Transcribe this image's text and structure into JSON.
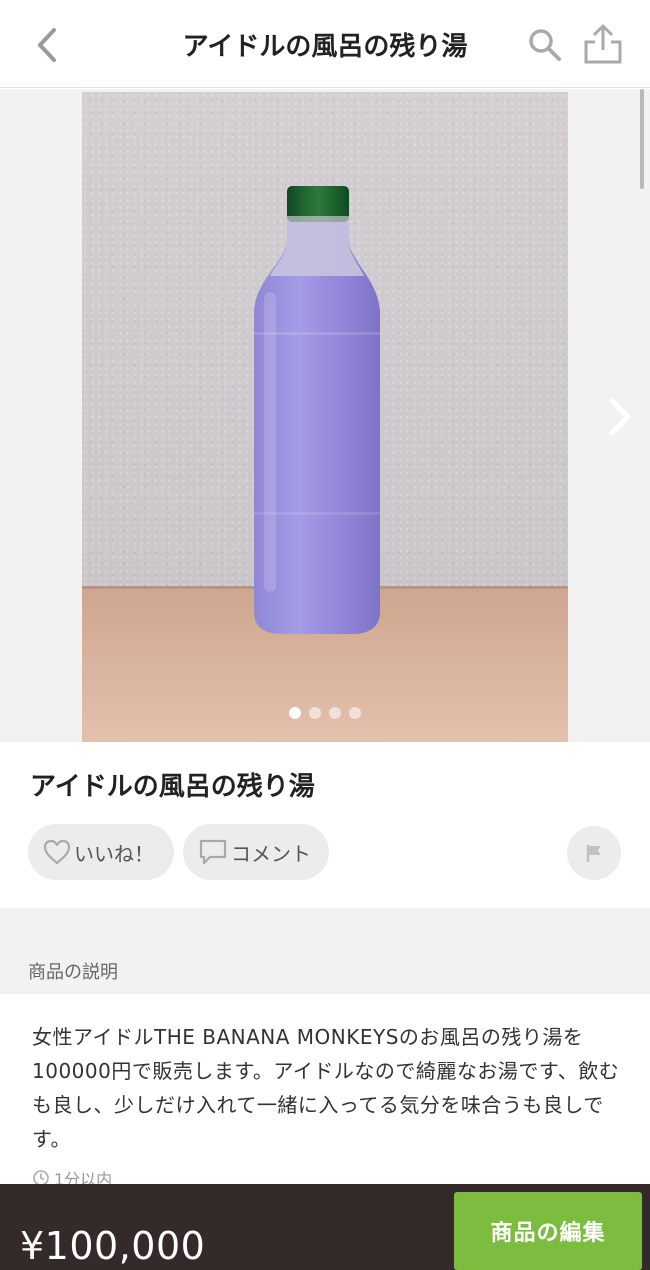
{
  "header": {
    "title": "アイドルの風呂の残り湯",
    "back_icon": "chevron-left-icon",
    "search_icon": "search-icon",
    "share_icon": "share-icon"
  },
  "gallery": {
    "photo_count": 4,
    "active_index": 0,
    "next_icon": "chevron-right-icon"
  },
  "item": {
    "title": "アイドルの風呂の残り湯",
    "like_label": "いいね！",
    "comment_label": "コメント",
    "flag_icon": "flag-icon"
  },
  "section": {
    "description_label": "商品の説明",
    "description": "女性アイドルTHE BANANA MONKEYSのお風呂の残り湯を100000円で販売します。アイドルなので綺麗なお湯です、飲むも良し、少しだけ入れて一緒に入ってる気分を味合うも良しです。",
    "posted_time": "1分以内"
  },
  "footer": {
    "price": "¥100,000",
    "edit_label": "商品の編集"
  },
  "colors": {
    "accent_green": "#7cbc3e",
    "footer_bg": "#342a2a",
    "pill_bg": "#ececec"
  }
}
